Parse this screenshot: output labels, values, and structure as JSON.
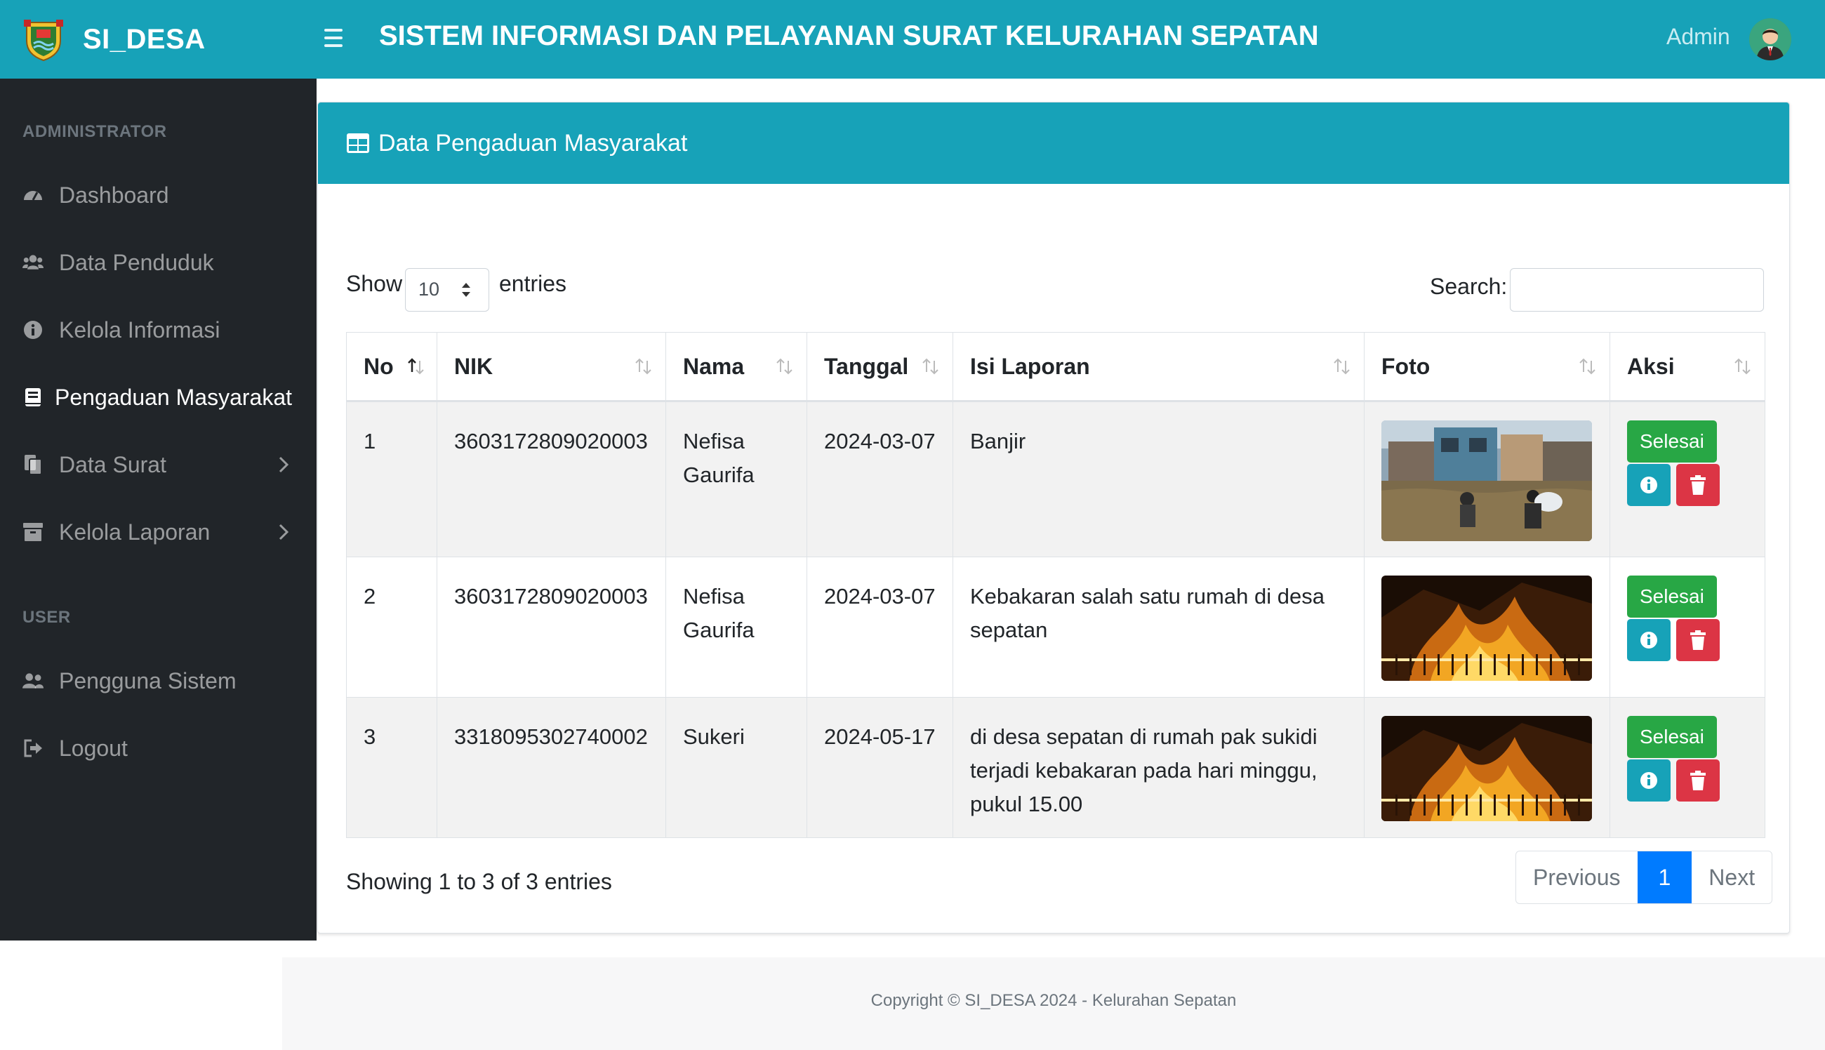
{
  "header": {
    "brand": "SI_DESA",
    "title": "SISTEM INFORMASI DAN PELAYANAN SURAT KELURAHAN SEPATAN",
    "user": "Admin"
  },
  "sidebar": {
    "section_admin": "ADMINISTRATOR",
    "section_user": "USER",
    "items": [
      {
        "label": "Dashboard",
        "icon": "dashboard-icon"
      },
      {
        "label": "Data Penduduk",
        "icon": "users-icon"
      },
      {
        "label": "Kelola Informasi",
        "icon": "info-icon"
      },
      {
        "label": "Pengaduan Masyarakat",
        "icon": "book-icon",
        "active": true
      },
      {
        "label": "Data Surat",
        "icon": "files-icon"
      },
      {
        "label": "Kelola Laporan",
        "icon": "archive-icon"
      },
      {
        "label": "Pengguna Sistem",
        "icon": "users-icon"
      },
      {
        "label": "Logout",
        "icon": "logout-icon"
      }
    ]
  },
  "card": {
    "title": "Data Pengaduan Masyarakat",
    "show_label": "Show",
    "entries_label": "entries",
    "page_length": "10",
    "search_label": "Search:"
  },
  "table": {
    "headers": [
      "No",
      "NIK",
      "Nama",
      "Tanggal",
      "Isi Laporan",
      "Foto",
      "Aksi"
    ],
    "rows": [
      {
        "no": "1",
        "nik": "3603172809020003",
        "nama": "Nefisa Gaurifa",
        "tanggal": "2024-03-07",
        "isi": "Banjir",
        "foto": "flood-photo",
        "aksi": "Selesai"
      },
      {
        "no": "2",
        "nik": "3603172809020003",
        "nama": "Nefisa Gaurifa",
        "tanggal": "2024-03-07",
        "isi": "Kebakaran salah satu rumah di desa sepatan",
        "foto": "fire-photo",
        "aksi": "Selesai"
      },
      {
        "no": "3",
        "nik": "3318095302740002",
        "nama": "Sukeri",
        "tanggal": "2024-05-17",
        "isi": "di desa sepatan di rumah pak sukidi terjadi kebakaran pada hari minggu, pukul 15.00",
        "foto": "fire-photo",
        "aksi": "Selesai"
      }
    ]
  },
  "pagination": {
    "info": "Showing 1 to 3 of 3 entries",
    "previous": "Previous",
    "current": "1",
    "next": "Next"
  },
  "footer": {
    "copyright": "Copyright © SI_DESA 2024 - Kelurahan Sepatan"
  },
  "colors": {
    "primary": "#17a2b8",
    "sidebar": "#212529",
    "success": "#28a745",
    "danger": "#dc3545",
    "page_active": "#007bff"
  }
}
